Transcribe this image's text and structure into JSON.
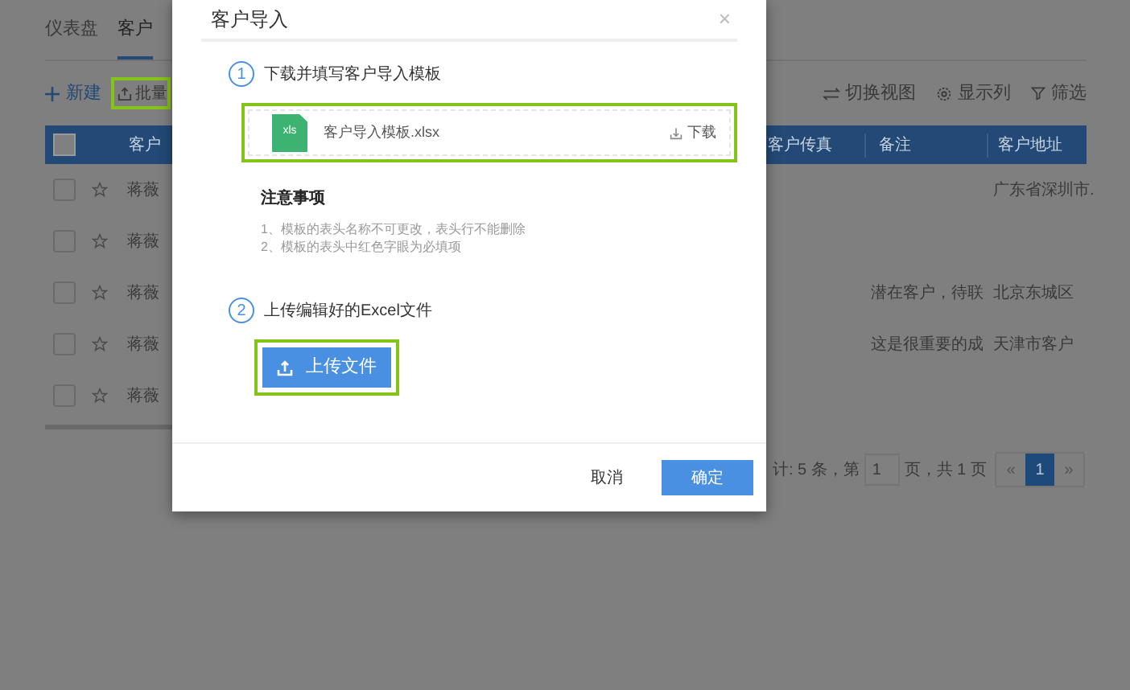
{
  "nav_tabs": [
    {
      "label": "仪表盘",
      "selected": false
    },
    {
      "label": "客户",
      "selected": true
    }
  ],
  "toolbar": {
    "new": "新建",
    "batch_import": {
      "label": "批量",
      "highlighted": true
    },
    "actions": [
      {
        "kind": "switch",
        "label": "切换视图"
      },
      {
        "kind": "columns",
        "label": "显示列"
      },
      {
        "kind": "filter",
        "label": "筛选"
      }
    ]
  },
  "table": {
    "header_checked": false,
    "columns": [
      "客户",
      "客户传真",
      "备注",
      "客户地址"
    ],
    "rows": [
      {
        "checked": false,
        "starred": false,
        "owner": "蒋薇",
        "address": "广东省深圳市."
      },
      {
        "checked": false,
        "starred": false,
        "owner": "蒋薇"
      },
      {
        "checked": false,
        "starred": false,
        "owner": "蒋薇",
        "remark": "潜在客户，待联",
        "address": "北京东城区"
      },
      {
        "checked": false,
        "starred": false,
        "owner": "蒋薇",
        "remark": "这是很重要的成",
        "address": "天津市客户"
      },
      {
        "checked": false,
        "starred": false,
        "owner": "蒋薇"
      }
    ]
  },
  "pagination": {
    "summary": "计: 5 条，第",
    "page": "1",
    "total": "页，共 1 页",
    "prev": "«",
    "pages": [
      {
        "label": "1",
        "selected": true
      }
    ],
    "next": "»"
  },
  "dialog": {
    "title": "客户导入",
    "close": "×",
    "steps": [
      {
        "number": "1",
        "label": "下载并填写客户导入模板"
      },
      {
        "number": "2",
        "label": "上传编辑好的Excel文件"
      }
    ],
    "template": {
      "badge": "xls",
      "file": "客户导入模板.xlsx",
      "download": "下载",
      "highlighted": true
    },
    "notes_title": "注意事项",
    "notes": [
      "1、模板的表头名称不可更改，表头行不能删除",
      "2、模板的表头中红色字眼为必填项"
    ],
    "upload": {
      "label": "上传文件",
      "highlighted": true
    },
    "buttons": [
      {
        "kind": "secondary",
        "label": "取消"
      },
      {
        "kind": "primary",
        "label": "确定"
      }
    ]
  }
}
